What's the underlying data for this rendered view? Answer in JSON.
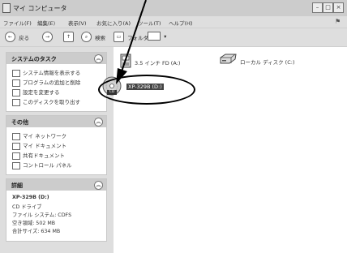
{
  "window": {
    "title": "マイ コンピュータ"
  },
  "menu": [
    "ファイル(F)",
    "編集(E)",
    "表示(V)",
    "お気に入り(A)",
    "ツール(T)",
    "ヘルプ(H)"
  ],
  "toolbar": {
    "back_label": "戻る",
    "search_label": "検索",
    "folders_label": "フォルダ"
  },
  "panels": {
    "system_tasks": {
      "title": "システムのタスク",
      "items": [
        "システム情報を表示する",
        "プログラムの追加と削除",
        "設定を変更する",
        "このディスクを取り出す"
      ]
    },
    "other_places": {
      "title": "その他",
      "items": [
        "マイ ネットワーク",
        "マイ ドキュメント",
        "共有ドキュメント",
        "コントロール パネル"
      ]
    },
    "details": {
      "title": "詳細",
      "name": "XP-329B (D:)",
      "type": "CD ドライブ",
      "filesystem": "ファイル システム: CDFS",
      "free": "空き領域: 502 MB",
      "total": "合計サイズ: 634 MB"
    }
  },
  "drives": {
    "floppy": "3.5 インチ FD (A:)",
    "local": "ローカル ディスク (C:)",
    "cd": "XP-329B (D:)",
    "cd_badge": "CD"
  }
}
